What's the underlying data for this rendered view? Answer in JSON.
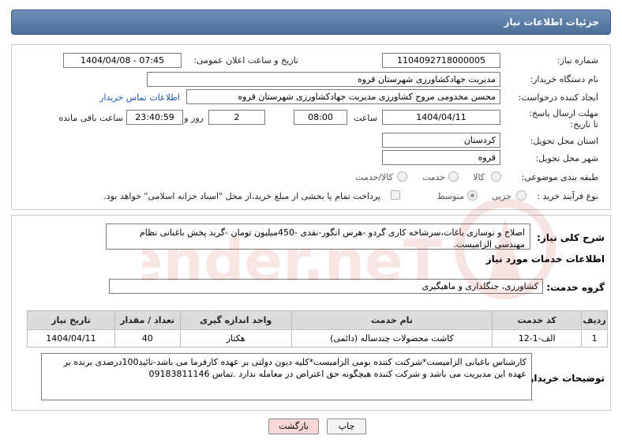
{
  "header": {
    "title": "جزئیات اطلاعات نیاز"
  },
  "form": {
    "need_number_label": "شماره نیاز:",
    "need_number": "1104092718000005",
    "announce_label": "تاریخ و ساعت اعلان عمومی:",
    "announce_value": "1404/04/08 - 07:45",
    "buyer_org_label": "نام دستگاه خریدار:",
    "buyer_org": "مدیریت جهادکشاورزی شهرستان قروه",
    "creator_label": "ایجاد کننده درخواست:",
    "creator": "محسن مخدومی مروج کشاورزی مدیریت جهادکشاورزی شهرستان قروه",
    "contact_link": "اطلاعات تماس خریدار",
    "deadline_label": "مهلت ارسال پاسخ: تا تاریخ:",
    "deadline_date": "1404/04/11",
    "time_label": "ساعت",
    "deadline_time": "08:00",
    "days_value": "2",
    "days_label": "روز و",
    "remaining_time": "23:40:59",
    "remaining_label": "ساعت باقی مانده",
    "province_label": "استان محل تحویل:",
    "province": "کردستان",
    "city_label": "شهر محل تحویل:",
    "city": "قروه",
    "category_label": "طبقه بندی موضوعی:",
    "category_options": [
      "کالا",
      "خدمت",
      "کالا/خدمت"
    ],
    "process_label": "نوع فرآیند خرید :",
    "process_options": [
      "جزیی",
      "متوسط"
    ],
    "treasury_note": "پرداخت تمام یا بخشی از مبلغ خرید،از محل \"اسناد خزانه اسلامی\" خواهد بود."
  },
  "summary": {
    "label": "شرح کلی نیاز:",
    "text": "اصلاح و نوسازی باغات،سرشاخه کاری گردو -هرس انگور-نقدی -450میلیون تومان -گرید پخش باغبانی نظام مهندسی الزامیست."
  },
  "services": {
    "section_title": "اطلاعات خدمات مورد نیاز",
    "group_label": "گروه خدمت:",
    "group_value": "کشاورزی، جنگلداری و ماهیگیری",
    "columns": [
      "ردیف",
      "کد خدمت",
      "نام خدمت",
      "واحد اندازه گیری",
      "تعداد / مقدار",
      "تاریخ نیاز"
    ],
    "rows": [
      [
        "1",
        "الف-1-12",
        "کاشت محصولات چندساله (دائمی)",
        "هکتار",
        "40",
        "1404/04/11"
      ]
    ]
  },
  "buyer_notes": {
    "label": "توضیحات خریدار:",
    "text": "کارشناس باغبانی الزامیست*شرکتت کننده بومی الزامیست*کلیه دیون دولتی بر عهده کارفرما می باشد-تائید100درصدی برنده بر عهده این مدیریت می باشد و شرکت کننده هیچگونه حق اعتراض در معامله ندارد .تماس 09183811146"
  },
  "buttons": {
    "print": "چاپ",
    "back": "بازگشت"
  },
  "watermark": {
    "text": "AriaTender.neT"
  }
}
